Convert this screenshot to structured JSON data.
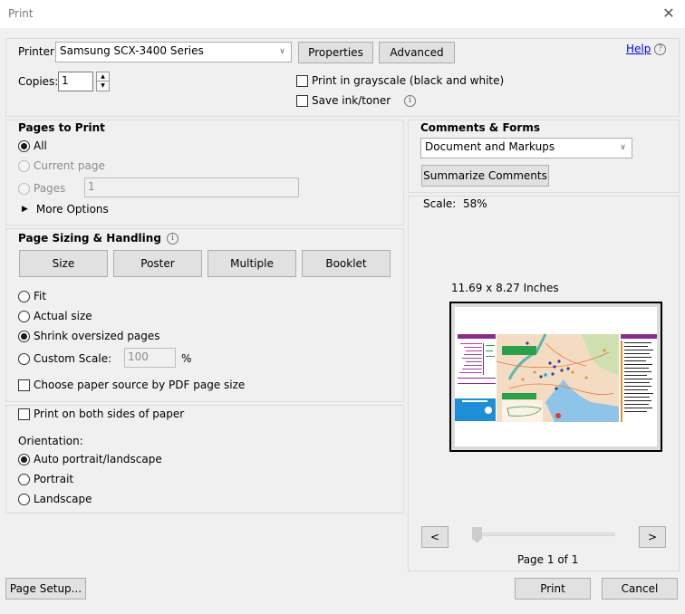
{
  "window": {
    "title": "Print",
    "close_icon": "close-icon"
  },
  "printer": {
    "label": "Printer:",
    "selected": "Samsung SCX-3400 Series",
    "properties_label": "Properties",
    "advanced_label": "Advanced",
    "help_label": "Help",
    "copies_label": "Copies:",
    "copies_value": "1",
    "grayscale_label": "Print in grayscale (black and white)",
    "grayscale_checked": false,
    "save_ink_label": "Save ink/toner",
    "save_ink_checked": false
  },
  "pages_to_print": {
    "heading": "Pages to Print",
    "options": [
      {
        "label": "All",
        "checked": true,
        "enabled": true
      },
      {
        "label": "Current page",
        "checked": false,
        "enabled": false
      },
      {
        "label": "Pages",
        "checked": false,
        "enabled": false
      }
    ],
    "pages_value": "1",
    "more_options_label": "More Options"
  },
  "page_sizing": {
    "heading": "Page Sizing & Handling",
    "tabs": [
      "Size",
      "Poster",
      "Multiple",
      "Booklet"
    ],
    "options": [
      {
        "label": "Fit",
        "checked": false
      },
      {
        "label": "Actual size",
        "checked": false
      },
      {
        "label": "Shrink oversized pages",
        "checked": true
      },
      {
        "label": "Custom Scale:",
        "checked": false
      }
    ],
    "custom_scale_value": "100",
    "percent_label": "%",
    "paper_source_label": "Choose paper source by PDF page size",
    "paper_source_checked": false
  },
  "duplex": {
    "both_sides_label": "Print on both sides of paper",
    "both_sides_checked": false,
    "orientation_label": "Orientation:",
    "orientation_options": [
      {
        "label": "Auto portrait/landscape",
        "checked": true
      },
      {
        "label": "Portrait",
        "checked": false
      },
      {
        "label": "Landscape",
        "checked": false
      }
    ]
  },
  "comments_forms": {
    "heading": "Comments & Forms",
    "selected": "Document and Markups",
    "summarize_label": "Summarize Comments"
  },
  "preview": {
    "scale_text": "Scale:  58%",
    "page_size_text": "11.69 x 8.27 Inches",
    "prev_label": "<",
    "next_label": ">",
    "page_indicator": "Page 1 of 1",
    "slider_position": 0
  },
  "footer": {
    "page_setup_label": "Page Setup...",
    "print_label": "Print",
    "cancel_label": "Cancel"
  }
}
